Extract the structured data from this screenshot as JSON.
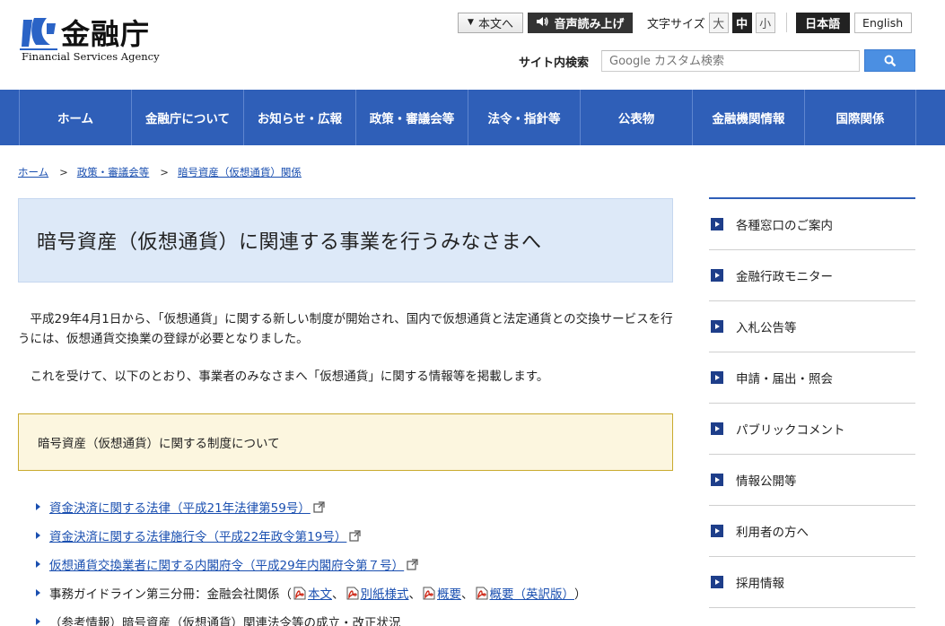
{
  "header": {
    "logo_jp": "金融庁",
    "logo_en": "Financial Services Agency",
    "skip_to_content": "本文へ",
    "voice_reading": "音声読み上げ",
    "font_size_label": "文字サイズ",
    "font_sizes": [
      "大",
      "中",
      "小"
    ],
    "font_size_selected": "中",
    "lang_jp": "日本語",
    "lang_en": "English",
    "search_label": "サイト内検索",
    "search_placeholder": "Google カスタム検索"
  },
  "nav": {
    "items": [
      "ホーム",
      "金融庁について",
      "お知らせ・広報",
      "政策・審議会等",
      "法令・指針等",
      "公表物",
      "金融機関情報",
      "国際関係"
    ]
  },
  "breadcrumb": {
    "items": [
      "ホーム",
      "政策・審議会等",
      "暗号資産（仮想通貨）関係"
    ],
    "separator": ">"
  },
  "main": {
    "title": "暗号資産（仮想通貨）に関連する事業を行うみなさまへ",
    "para1": "　平成29年4月1日から、「仮想通貨」に関する新しい制度が開始され、国内で仮想通貨と法定通貨との交換サービスを行うには、仮想通貨交換業の登録が必要となりました。",
    "para2": "　これを受けて、以下のとおり、事業者のみなさまへ「仮想通貨」に関する情報等を掲載します。",
    "notice": "暗号資産（仮想通貨）に関する制度について",
    "links": [
      "資金決済に関する法律（平成21年法律第59号）",
      "資金決済に関する法律施行令（平成22年政令第19号）",
      "仮想通貨交換業者に関する内閣府令（平成29年内閣府令第７号）"
    ],
    "guideline_prefix": "事務ガイドライン第三分冊：金融会社関係（",
    "guideline_links": [
      "本文",
      "別紙様式",
      "概要",
      "概要（英訳版）"
    ],
    "guideline_sep": "、",
    "guideline_suffix": "）",
    "reference_item": "（参考情報）暗号資産（仮想通貨）関連法令等の成立・改正状況"
  },
  "sidebar": {
    "items": [
      "各種窓口のご案内",
      "金融行政モニター",
      "入札公告等",
      "申請・届出・照会",
      "パブリックコメント",
      "情報公開等",
      "利用者の方へ",
      "採用情報"
    ]
  },
  "colors": {
    "nav_bg": "#2f5fb8",
    "title_bg": "#dde9f8",
    "notice_bg": "#fcf6df",
    "notice_border": "#c9aa2e",
    "link": "#1a4fb0",
    "search_button": "#4b8fe2"
  }
}
